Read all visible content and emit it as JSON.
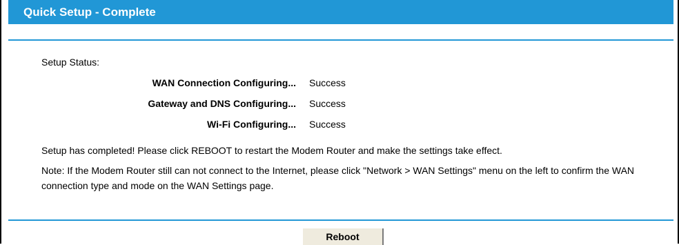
{
  "header": {
    "title": "Quick Setup - Complete"
  },
  "status": {
    "label": "Setup Status:",
    "rows": [
      {
        "name": "WAN Connection Configuring...",
        "value": "Success"
      },
      {
        "name": "Gateway and DNS Configuring...",
        "value": "Success"
      },
      {
        "name": "Wi-Fi Configuring...",
        "value": "Success"
      }
    ]
  },
  "message": "Setup has completed! Please click REBOOT to restart the Modem Router and make the settings take effect.",
  "note": "Note: If the Modem Router still can not connect to the Internet, please click \"Network > WAN Settings\" menu on the left to confirm the WAN connection type and mode on the WAN Settings page.",
  "actions": {
    "reboot_label": "Reboot"
  },
  "colors": {
    "accent": "#2197d6",
    "button_bg": "#efebde"
  }
}
